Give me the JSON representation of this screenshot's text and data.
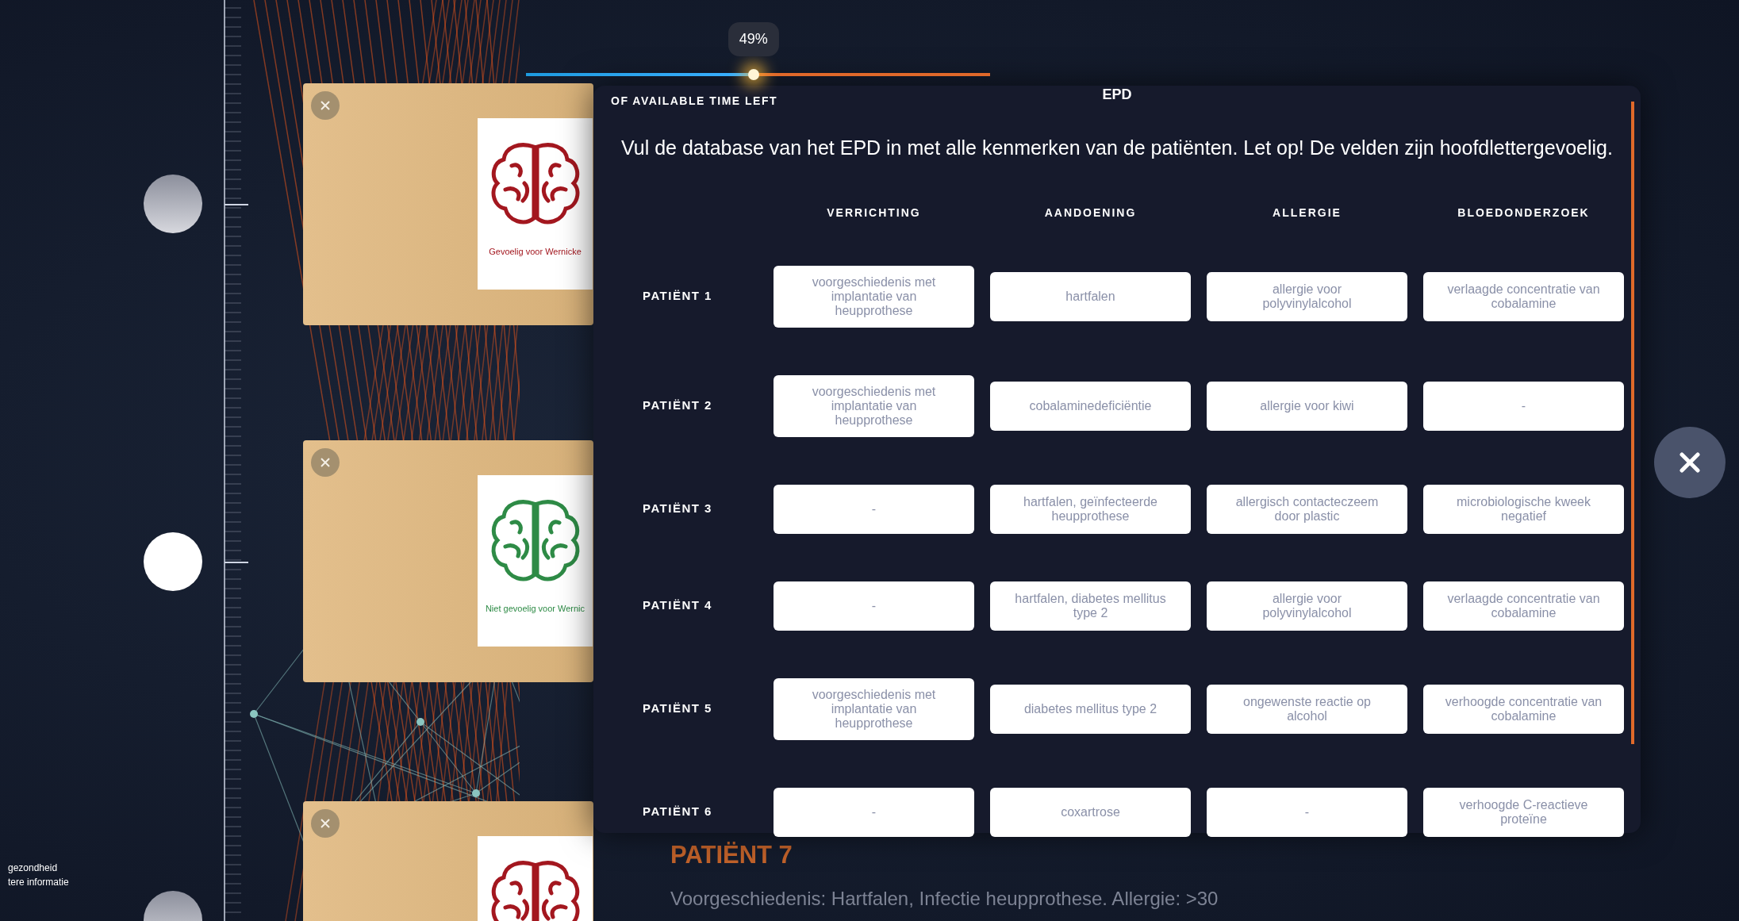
{
  "timer": {
    "reading": "49%",
    "level": 0.49,
    "caption": "OF AVAILABLE TIME LEFT"
  },
  "timeline": [
    {
      "selected": false
    },
    {
      "selected": true
    },
    {
      "selected": false
    }
  ],
  "folders": [
    {
      "color": "#a3171f",
      "caption": "Gevoelig voor Wernicke"
    },
    {
      "color": "#2e8b46",
      "caption": "Niet gevoelig voor Wernic"
    },
    {
      "color": "#a3171f"
    }
  ],
  "side_notes": [
    "gezondheid",
    "tere informatie"
  ],
  "modal": {
    "title": "EPD",
    "instruction": "Vul de database van het EPD in met alle kenmerken van de patiënten. Let op! De velden zijn hoofdlettergevoelig.",
    "columns": [
      "VERRICHTING",
      "AANDOENING",
      "ALLERGIE",
      "BLOEDONDERZOEK"
    ],
    "rows": [
      {
        "label": "PATIËNT 1",
        "cells": [
          "voorgeschiedenis met implantatie van heupprothese",
          "hartfalen",
          "allergie voor polyvinylalcohol",
          "verlaagde concentratie van cobalamine"
        ]
      },
      {
        "label": "PATIËNT 2",
        "cells": [
          "voorgeschiedenis met implantatie van heupprothese",
          "cobalaminedeficiëntie",
          "allergie voor kiwi",
          "-"
        ]
      },
      {
        "label": "PATIËNT 3",
        "cells": [
          "-",
          "hartfalen, geïnfecteerde heupprothese",
          "allergisch contacteczeem door plastic",
          "microbiologische kweek negatief"
        ]
      },
      {
        "label": "PATIËNT 4",
        "cells": [
          "-",
          "hartfalen, diabetes mellitus type 2",
          "allergie voor polyvinylalcohol",
          "verlaagde concentratie van cobalamine"
        ]
      },
      {
        "label": "PATIËNT 5",
        "cells": [
          "voorgeschiedenis met implantatie van heupprothese",
          "diabetes mellitus type 2",
          "ongewenste reactie op alcohol",
          "verhoogde concentratie van cobalamine"
        ]
      },
      {
        "label": "PATIËNT 6",
        "cells": [
          "-",
          "coxartrose",
          "-",
          "verhoogde C-reactieve proteïne"
        ]
      }
    ]
  },
  "background_case": {
    "title": "PATIËNT 7",
    "text": "Voorgeschiedenis: Hartfalen, Infectie heupprothese. Allergie: >30"
  }
}
